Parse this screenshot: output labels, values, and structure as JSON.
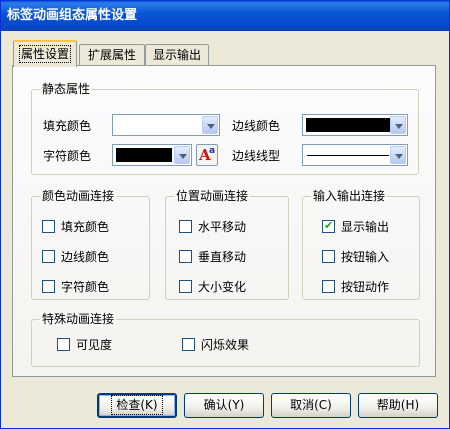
{
  "window": {
    "title": "标签动画组态属性设置"
  },
  "tabs": [
    {
      "label": "属性设置"
    },
    {
      "label": "扩展属性"
    },
    {
      "label": "显示输出"
    }
  ],
  "static": {
    "title": "静态属性",
    "fill_label": "填充颜色",
    "border_label": "边线颜色",
    "char_label": "字符颜色",
    "line_label": "边线线型"
  },
  "color_anim": {
    "title": "颜色动画连接",
    "items": [
      {
        "label": "填充颜色",
        "checked": false
      },
      {
        "label": "边线颜色",
        "checked": false
      },
      {
        "label": "字符颜色",
        "checked": false
      }
    ]
  },
  "pos_anim": {
    "title": "位置动画连接",
    "items": [
      {
        "label": "水平移动",
        "checked": false
      },
      {
        "label": "垂直移动",
        "checked": false
      },
      {
        "label": "大小变化",
        "checked": false
      }
    ]
  },
  "io": {
    "title": "输入输出连接",
    "items": [
      {
        "label": "显示输出",
        "checked": true
      },
      {
        "label": "按钮输入",
        "checked": false
      },
      {
        "label": "按钮动作",
        "checked": false
      }
    ]
  },
  "special": {
    "title": "特殊动画连接",
    "items": [
      {
        "label": "可见度",
        "checked": false
      },
      {
        "label": "闪烁效果",
        "checked": false
      }
    ]
  },
  "buttons": {
    "check": "检查(K)",
    "ok": "确认(Y)",
    "cancel": "取消(C)",
    "help": "帮助(H)"
  },
  "colors": {
    "fill": "#ffffff",
    "border": "#000000",
    "char": "#000000",
    "check_mark": "#21a121",
    "titlebar": "#0b56d6"
  },
  "icons": {
    "font": "font-color-icon",
    "dropdown": "chevron-down-icon",
    "check": "check-icon"
  }
}
